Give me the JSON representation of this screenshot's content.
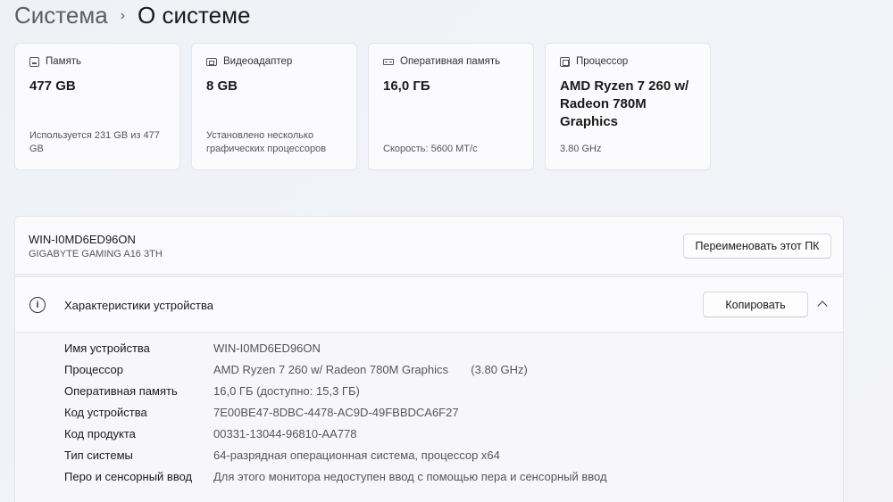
{
  "breadcrumb": {
    "parent": "Система",
    "separator": "›",
    "current": "О системе"
  },
  "cards": [
    {
      "icon": "drive-icon",
      "title": "Память",
      "value": "477 GB",
      "sub": "Используется 231 GB из 477 GB"
    },
    {
      "icon": "gpu-icon",
      "title": "Видеоадаптер",
      "value": "8 GB",
      "sub": "Установлено несколько графических процессоров"
    },
    {
      "icon": "ram-icon",
      "title": "Оперативная память",
      "value": "16,0 ГБ",
      "sub": "Скорость: 5600 MT/c"
    },
    {
      "icon": "cpu-icon",
      "title": "Процессор",
      "value": "AMD Ryzen 7 260 w/ Radeon 780M Graphics",
      "sub": "3.80 GHz"
    }
  ],
  "device": {
    "name": "WIN-I0MD6ED96ON",
    "model": "GIGABYTE GAMING A16 3TH",
    "rename_label": "Переименовать этот ПК"
  },
  "specs": {
    "title": "Характеристики устройства",
    "copy_label": "Копировать",
    "rows": [
      {
        "label": "Имя устройства",
        "value": "WIN-I0MD6ED96ON"
      },
      {
        "label": "Процессор",
        "value": "AMD Ryzen 7 260 w/ Radeon 780M Graphics       (3.80 GHz)"
      },
      {
        "label": "Оперативная память",
        "value": "16,0 ГБ (доступно: 15,3 ГБ)"
      },
      {
        "label": "Код устройства",
        "value": "7E00BE47-8DBC-4478-AC9D-49FBBDCA6F27"
      },
      {
        "label": "Код продукта",
        "value": "00331-13044-96810-AA778"
      },
      {
        "label": "Тип системы",
        "value": "64-разрядная операционная система, процессор x64"
      },
      {
        "label": "Перо и сенсорный ввод",
        "value": "Для этого монитора недоступен ввод с помощью пера и сенсорный ввод"
      }
    ]
  }
}
